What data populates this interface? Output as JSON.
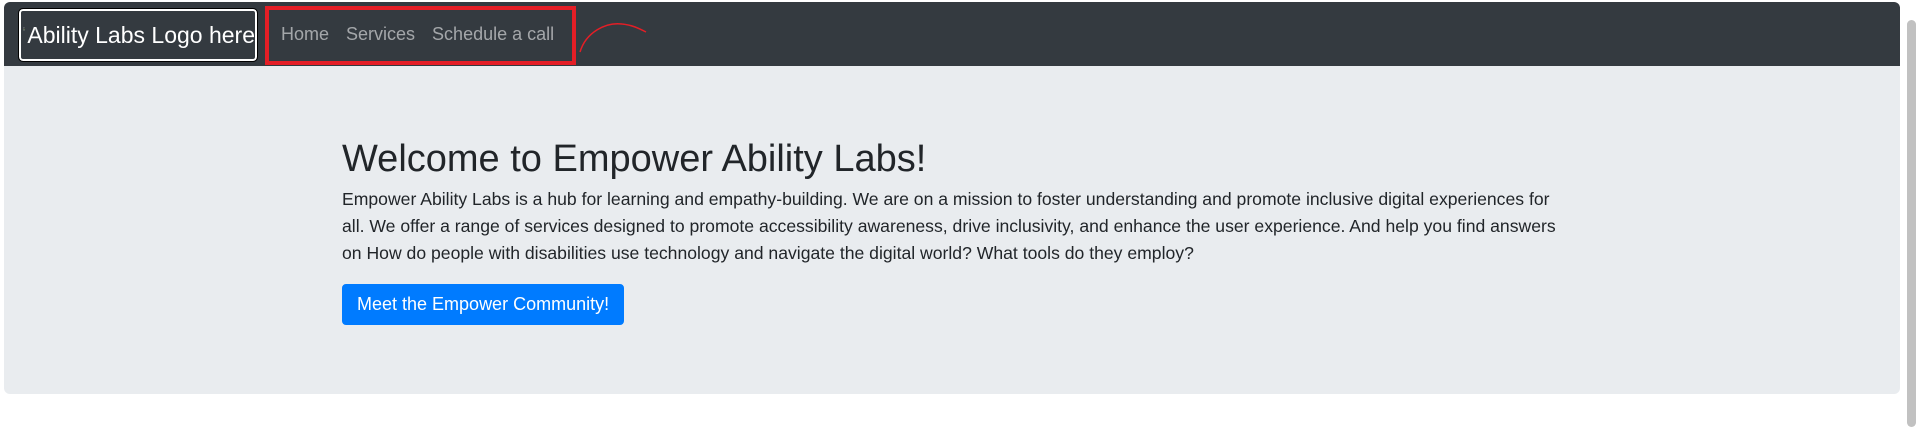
{
  "navbar": {
    "logo_alt": "Ability Labs Logo here",
    "links": [
      {
        "label": "Home"
      },
      {
        "label": "Services"
      },
      {
        "label": "Schedule a call"
      }
    ]
  },
  "hero": {
    "title": "Welcome to Empower Ability Labs!",
    "description": "Empower Ability Labs is a hub for learning and empathy-building. We are on a mission to foster understanding and promote inclusive digital experiences for all. We offer a range of services designed to promote accessibility awareness, drive inclusivity, and enhance the user experience. And help you find answers on How do people with disabilities use technology and navigate the digital world? What tools do they employ?",
    "cta_label": "Meet the Empower Community!"
  },
  "colors": {
    "navbar_bg": "#343a40",
    "hero_bg": "#e9ecef",
    "primary": "#007bff",
    "annotation": "#e41e26"
  }
}
